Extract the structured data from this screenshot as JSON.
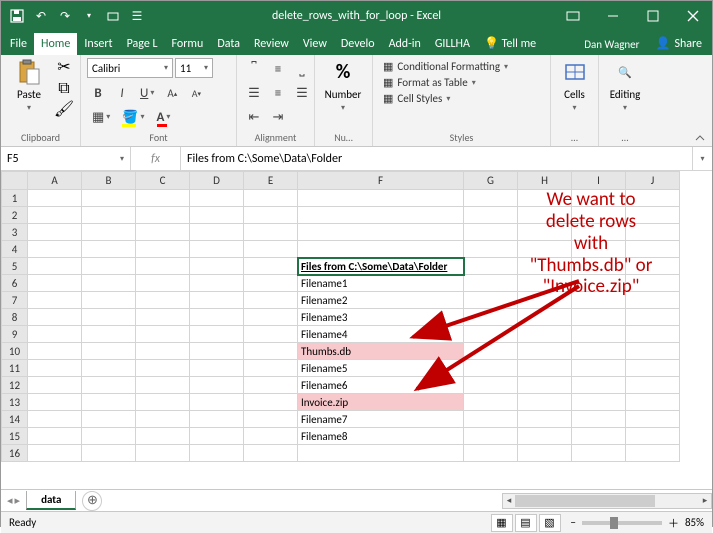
{
  "title": "delete_rows_with_for_loop - Excel",
  "menus": {
    "file": "File",
    "home": "Home",
    "insert": "Insert",
    "pagel": "Page L",
    "formu": "Formu",
    "data": "Data",
    "review": "Review",
    "view": "View",
    "develo": "Develo",
    "addins": "Add-in",
    "gillha": "GILLHA",
    "tellme": "Tell me"
  },
  "user": "Dan Wagner",
  "share": "Share",
  "ribbon": {
    "clipboard": {
      "label": "Clipboard",
      "paste": "Paste"
    },
    "font": {
      "label": "Font",
      "name": "Calibri",
      "size": "11"
    },
    "alignment": {
      "label": "Alignment"
    },
    "number": {
      "label": "Nu…",
      "big": "Number",
      "pct": "%"
    },
    "styles": {
      "label": "Styles",
      "cond": "Conditional Formatting",
      "table": "Format as Table",
      "cell": "Cell Styles"
    },
    "cells": {
      "label": "…",
      "big": "Cells"
    },
    "editing": {
      "label": "…",
      "big": "Editing"
    }
  },
  "namebox": "F5",
  "formula": "Files from C:\\Some\\Data\\Folder",
  "fx": "fx",
  "columns": [
    "A",
    "B",
    "C",
    "D",
    "E",
    "F",
    "G",
    "H",
    "I",
    "J"
  ],
  "rows": {
    "5": {
      "F": "Files from C:\\Some\\Data\\Folder",
      "sel": true
    },
    "6": {
      "F": "Filename1"
    },
    "7": {
      "F": "Filename2"
    },
    "8": {
      "F": "Filename3"
    },
    "9": {
      "F": "Filename4"
    },
    "10": {
      "F": "Thumbs.db",
      "hl": true
    },
    "11": {
      "F": "Filename5"
    },
    "12": {
      "F": "Filename6"
    },
    "13": {
      "F": "Invoice.zip",
      "hl": true
    },
    "14": {
      "F": "Filename7"
    },
    "15": {
      "F": "Filename8"
    }
  },
  "annotation": "We want to\ndelete rows\nwith\n\"Thumbs.db\" or\n\"Invoice.zip\"",
  "sheet": "data",
  "status": {
    "ready": "Ready",
    "zoom": "85%"
  }
}
